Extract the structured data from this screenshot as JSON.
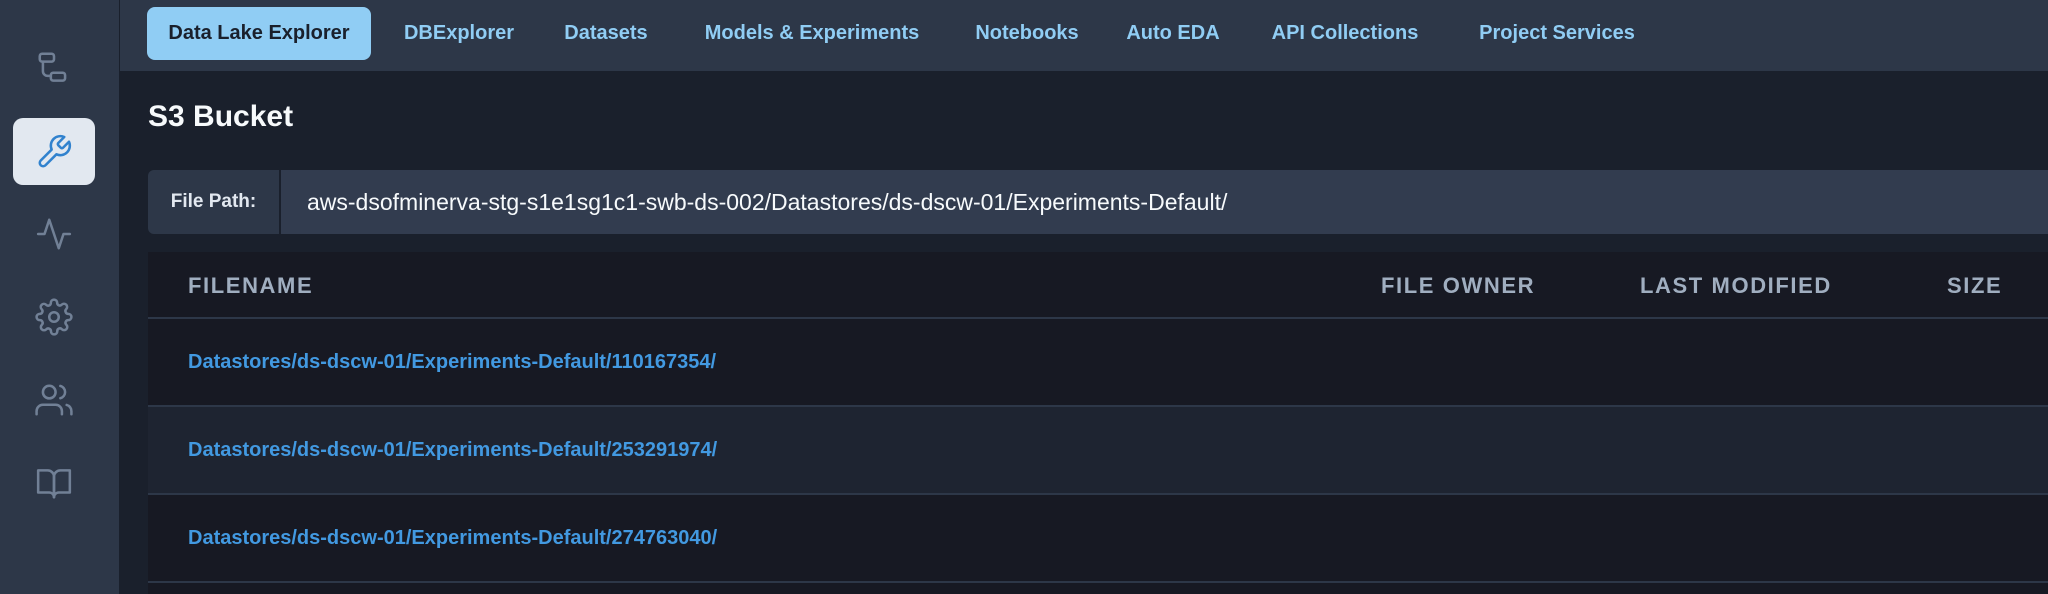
{
  "rail": {
    "items": [
      {
        "icon": "workflow-icon",
        "active": false
      },
      {
        "icon": "wrench-icon",
        "active": true
      },
      {
        "icon": "activity-icon",
        "active": false
      },
      {
        "icon": "gear-icon",
        "active": false
      },
      {
        "icon": "users-icon",
        "active": false
      },
      {
        "icon": "book-icon",
        "active": false
      }
    ]
  },
  "nav": {
    "tabs": [
      {
        "label": "Data Lake Explorer",
        "active": true
      },
      {
        "label": "DBExplorer",
        "active": false
      },
      {
        "label": "Datasets",
        "active": false
      },
      {
        "label": "Models & Experiments",
        "active": false
      },
      {
        "label": "Notebooks",
        "active": false
      },
      {
        "label": "Auto EDA",
        "active": false
      },
      {
        "label": "API Collections",
        "active": false
      },
      {
        "label": "Project Services",
        "active": false
      }
    ]
  },
  "main": {
    "title": "S3 Bucket",
    "path_label": "File Path:",
    "path_value": "aws-dsofminerva-stg-s1e1sg1c1-swb-ds-002/Datastores/ds-dscw-01/Experiments-Default/"
  },
  "table": {
    "columns": [
      "FILENAME",
      "FILE OWNER",
      "LAST MODIFIED",
      "SIZE"
    ],
    "rows": [
      {
        "filename": "Datastores/ds-dscw-01/Experiments-Default/110167354/",
        "owner": "",
        "modified": "",
        "size": ""
      },
      {
        "filename": "Datastores/ds-dscw-01/Experiments-Default/253291974/",
        "owner": "",
        "modified": "",
        "size": ""
      },
      {
        "filename": "Datastores/ds-dscw-01/Experiments-Default/274763040/",
        "owner": "",
        "modified": "",
        "size": ""
      }
    ]
  },
  "colors": {
    "accent": "#90cdf4",
    "link": "#4299e1",
    "background": "#1a202c",
    "panel": "#2d3748"
  }
}
